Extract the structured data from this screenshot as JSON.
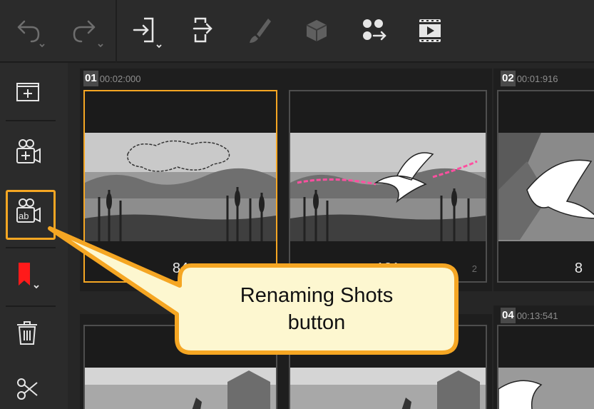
{
  "toolbar": {
    "buttons": [
      {
        "name": "undo-icon"
      },
      {
        "name": "redo-icon"
      },
      {
        "name": "import-icon"
      },
      {
        "name": "export-icon"
      },
      {
        "name": "brush-icon"
      },
      {
        "name": "3d-object-icon"
      },
      {
        "name": "puppet-icon"
      },
      {
        "name": "play-film-icon"
      }
    ]
  },
  "sidebar": {
    "buttons": [
      {
        "name": "new-panel-icon"
      },
      {
        "name": "new-shot-icon"
      },
      {
        "name": "rename-shots-icon"
      },
      {
        "name": "bookmark-icon",
        "color": "#ff1a1a"
      },
      {
        "name": "delete-icon"
      },
      {
        "name": "split-icon"
      }
    ]
  },
  "shots": [
    {
      "number": "01",
      "duration": "00:02:000"
    },
    {
      "number": "02",
      "duration": "00:01:916"
    },
    {
      "number": "04",
      "duration": "00:13:541"
    }
  ],
  "panels": [
    {
      "frames": "84",
      "index": "1",
      "selected": true
    },
    {
      "frames": "121",
      "index": "2",
      "selected": false
    },
    {
      "frames": "8",
      "index": "",
      "selected": false
    }
  ],
  "callout": {
    "text": "Renaming Shots\nbutton",
    "fill": "#fdf7d0",
    "border": "#f5a623"
  },
  "colors": {
    "accent": "#f5a623",
    "bookmark": "#ff1a1a",
    "arrow": "#ff4fa0"
  }
}
